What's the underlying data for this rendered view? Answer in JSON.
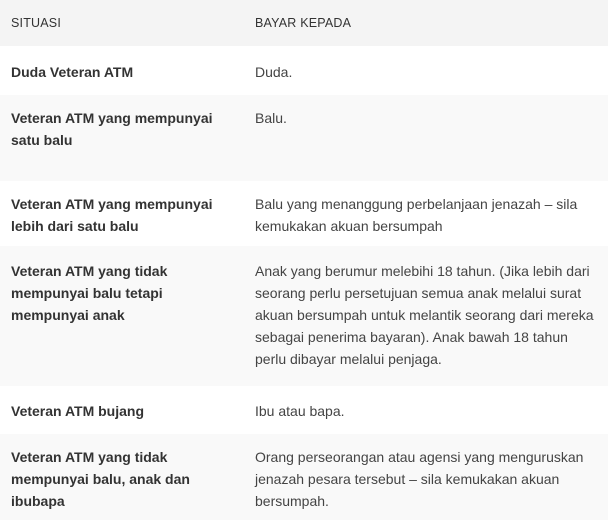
{
  "table": {
    "headers": [
      "SITUASI",
      "BAYAR KEPADA"
    ],
    "rows": [
      {
        "situasi": "Duda Veteran ATM",
        "bayar": "Duda."
      },
      {
        "situasi": "Veteran ATM yang mempunyai satu balu",
        "bayar": "Balu."
      },
      {
        "situasi": "Veteran ATM yang mempunyai lebih dari satu balu",
        "bayar": "Balu yang menanggung perbelanjaan jenazah – sila kemukakan akuan bersumpah"
      },
      {
        "situasi": "Veteran ATM yang tidak mempunyai balu tetapi mempunyai anak",
        "bayar": "Anak yang berumur melebihi 18 tahun. (Jika lebih dari seorang perlu persetujuan semua anak melalui surat akuan bersumpah untuk melantik seorang dari mereka sebagai penerima bayaran). Anak bawah 18 tahun perlu dibayar melalui penjaga."
      },
      {
        "situasi": "Veteran ATM bujang",
        "bayar": "Ibu atau bapa."
      },
      {
        "situasi": "Veteran ATM yang tidak mempunyai balu, anak dan ibubapa",
        "bayar": "Orang perseorangan atau agensi yang menguruskan jenazah pesara tersebut – sila kemukakan akuan bersumpah."
      }
    ]
  }
}
